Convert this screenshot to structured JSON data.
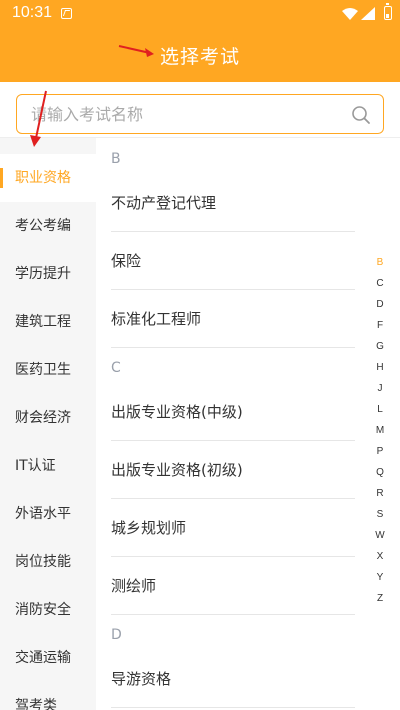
{
  "status_bar": {
    "time": "10:31"
  },
  "header": {
    "title": "选择考试"
  },
  "search": {
    "placeholder": "请输入考试名称"
  },
  "sidebar": {
    "items": [
      {
        "label": "职业资格",
        "active": true
      },
      {
        "label": "考公考编"
      },
      {
        "label": "学历提升"
      },
      {
        "label": "建筑工程"
      },
      {
        "label": "医药卫生"
      },
      {
        "label": "财会经济"
      },
      {
        "label": "IT认证"
      },
      {
        "label": "外语水平"
      },
      {
        "label": "岗位技能"
      },
      {
        "label": "消防安全"
      },
      {
        "label": "交通运输"
      },
      {
        "label": "驾考类"
      }
    ]
  },
  "list": {
    "sections": [
      {
        "letter": "B",
        "items": [
          "不动产登记代理",
          "保险",
          "标准化工程师"
        ]
      },
      {
        "letter": "C",
        "items": [
          "出版专业资格(中级)",
          "出版专业资格(初级)",
          "城乡规划师",
          "测绘师"
        ]
      },
      {
        "letter": "D",
        "items": [
          "导游资格"
        ]
      }
    ]
  },
  "index": {
    "letters": [
      "B",
      "C",
      "D",
      "F",
      "G",
      "H",
      "J",
      "L",
      "M",
      "P",
      "Q",
      "R",
      "S",
      "W",
      "X",
      "Y",
      "Z"
    ],
    "active": "B"
  },
  "colors": {
    "accent": "#FFA722",
    "annotation": "#E02020"
  }
}
